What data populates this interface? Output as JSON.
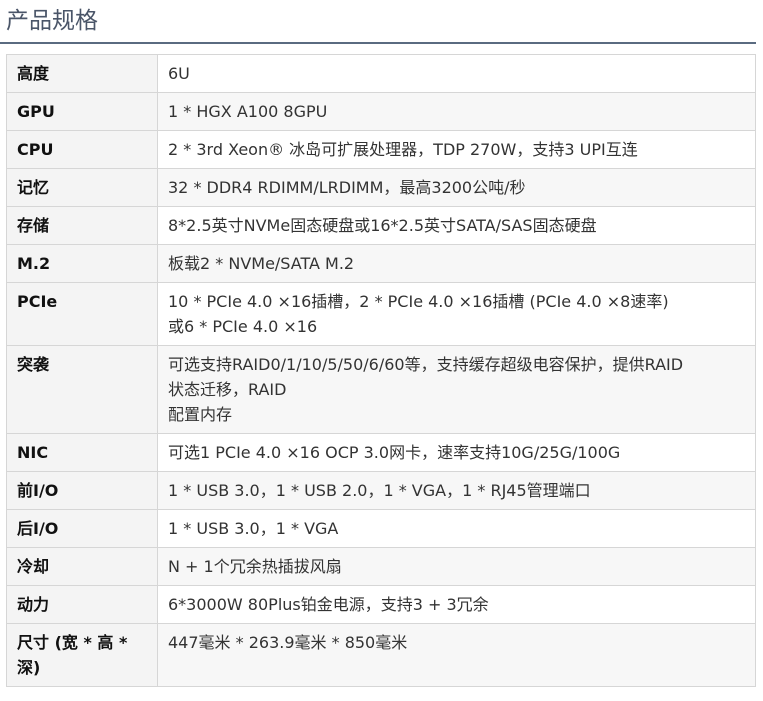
{
  "page": {
    "title": "产品规格"
  },
  "specs": [
    {
      "label": "高度",
      "value": [
        "6U"
      ]
    },
    {
      "label": "GPU",
      "value": [
        "1 * HGX A100 8GPU"
      ]
    },
    {
      "label": "CPU",
      "value": [
        "2 * 3rd Xeon® 冰岛可扩展处理器，TDP 270W，支持3 UPI互连"
      ]
    },
    {
      "label": "记忆",
      "value": [
        "32 * DDR4 RDIMM/LRDIMM，最高3200公吨/秒"
      ]
    },
    {
      "label": "存储",
      "value": [
        "8*2.5英寸NVMe固态硬盘或16*2.5英寸SATA/SAS固态硬盘"
      ]
    },
    {
      "label": "M.2",
      "value": [
        "板载2 * NVMe/SATA M.2"
      ]
    },
    {
      "label": "PCIe",
      "value": [
        "10 * PCIe 4.0 ×16插槽，2 * PCIe 4.0 ×16插槽 (PCIe 4.0 ×8速率)",
        "或6 * PCIe 4.0 ×16"
      ]
    },
    {
      "label": "突袭",
      "value": [
        "可选支持RAID0/1/10/5/50/6/60等，支持缓存超级电容保护，提供RAID",
        "状态迁移，RAID",
        "配置内存"
      ]
    },
    {
      "label": "NIC",
      "value": [
        "可选1 PCIe 4.0 ×16 OCP 3.0网卡，速率支持10G/25G/100G"
      ]
    },
    {
      "label": "前I/O",
      "value": [
        "1 * USB 3.0，1 * USB 2.0，1 * VGA，1 * RJ45管理端口"
      ]
    },
    {
      "label": "后I/O",
      "value": [
        "1 * USB 3.0，1 * VGA"
      ]
    },
    {
      "label": "冷却",
      "value": [
        "N + 1个冗余热插拔风扇"
      ]
    },
    {
      "label": "动力",
      "value": [
        "6*3000W 80Plus铂金电源，支持3 + 3冗余"
      ]
    },
    {
      "label": "尺寸 (宽 * 高 * 深)",
      "value": [
        "447毫米 * 263.9毫米 * 850毫米"
      ]
    }
  ]
}
